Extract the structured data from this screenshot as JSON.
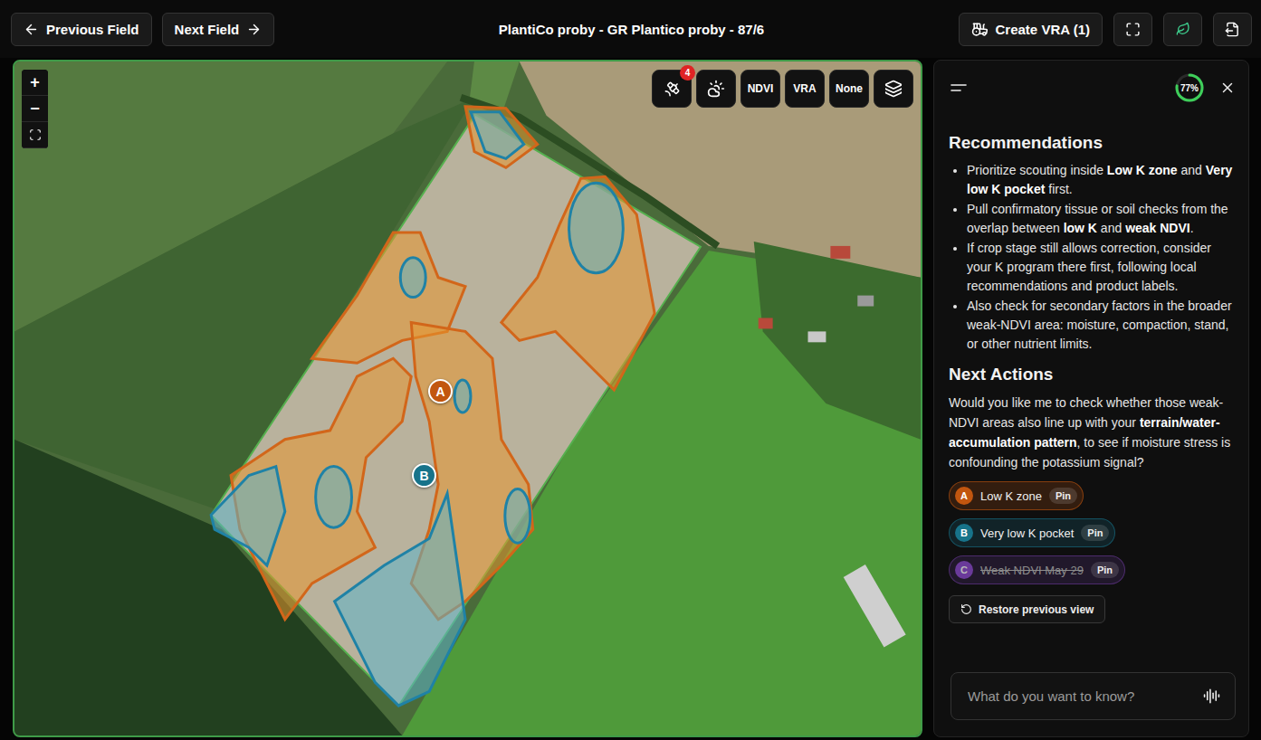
{
  "topbar": {
    "previous_button": "Previous Field",
    "next_button": "Next Field",
    "title": "PlantiCo proby - GR Plantico proby - 87/6",
    "create_button": "Create VRA (1)"
  },
  "map": {
    "zoom_in": "+",
    "zoom_out": "−",
    "alerts_badge": "4",
    "layer_buttons": [
      {
        "label": "NDVI",
        "selected": false
      },
      {
        "label": "VRA",
        "selected": false
      },
      {
        "label": "None",
        "selected": false
      }
    ],
    "pins": [
      {
        "letter": "A",
        "color": "#c2560f"
      },
      {
        "letter": "B",
        "color": "#17738a"
      }
    ]
  },
  "panel": {
    "progress": {
      "reading": "77%",
      "level": 0.77
    },
    "sections": [
      {
        "heading": "Recommendations",
        "bullets": [
          [
            {
              "text": "Prioritize scouting inside ",
              "bold": false
            },
            {
              "text": "Low K zone",
              "bold": true
            },
            {
              "text": " and ",
              "bold": false
            },
            {
              "text": "Very low K pocket",
              "bold": true
            },
            {
              "text": " first.",
              "bold": false
            }
          ],
          [
            {
              "text": "Pull confirmatory tissue or soil checks from the overlap between ",
              "bold": false
            },
            {
              "text": "low K",
              "bold": true
            },
            {
              "text": " and ",
              "bold": false
            },
            {
              "text": "weak NDVI",
              "bold": true
            },
            {
              "text": ".",
              "bold": false
            }
          ],
          [
            {
              "text": "If crop stage still allows correction, consider your K program there first, following local recommendations and product labels.",
              "bold": false
            }
          ],
          [
            {
              "text": "Also check for secondary factors in the broader weak-NDVI area: moisture, compaction, stand, or other nutrient limits.",
              "bold": false
            }
          ]
        ]
      }
    ],
    "next_actions": {
      "heading": "Next Actions",
      "paragraph": [
        {
          "text": "Would you like me to check whether those weak-NDVI areas also line up with your ",
          "bold": false
        },
        {
          "text": "terrain/water-accumulation pattern",
          "bold": true
        },
        {
          "text": ", to see if moisture stress is confounding the potassium signal?",
          "bold": false
        }
      ]
    },
    "pins": [
      {
        "letter": "A",
        "label": "Low K zone",
        "action": "Pin",
        "color": "#c2560f",
        "struck": false
      },
      {
        "letter": "B",
        "label": "Very low K pocket",
        "action": "Pin",
        "color": "#17738a",
        "struck": false
      },
      {
        "letter": "C",
        "label": "Weak NDVI May 29",
        "action": "Pin",
        "color": "#6a3a9a",
        "struck": true
      }
    ],
    "restore_button": "Restore previous view",
    "input": {
      "placeholder": "What do you want to know?"
    }
  }
}
